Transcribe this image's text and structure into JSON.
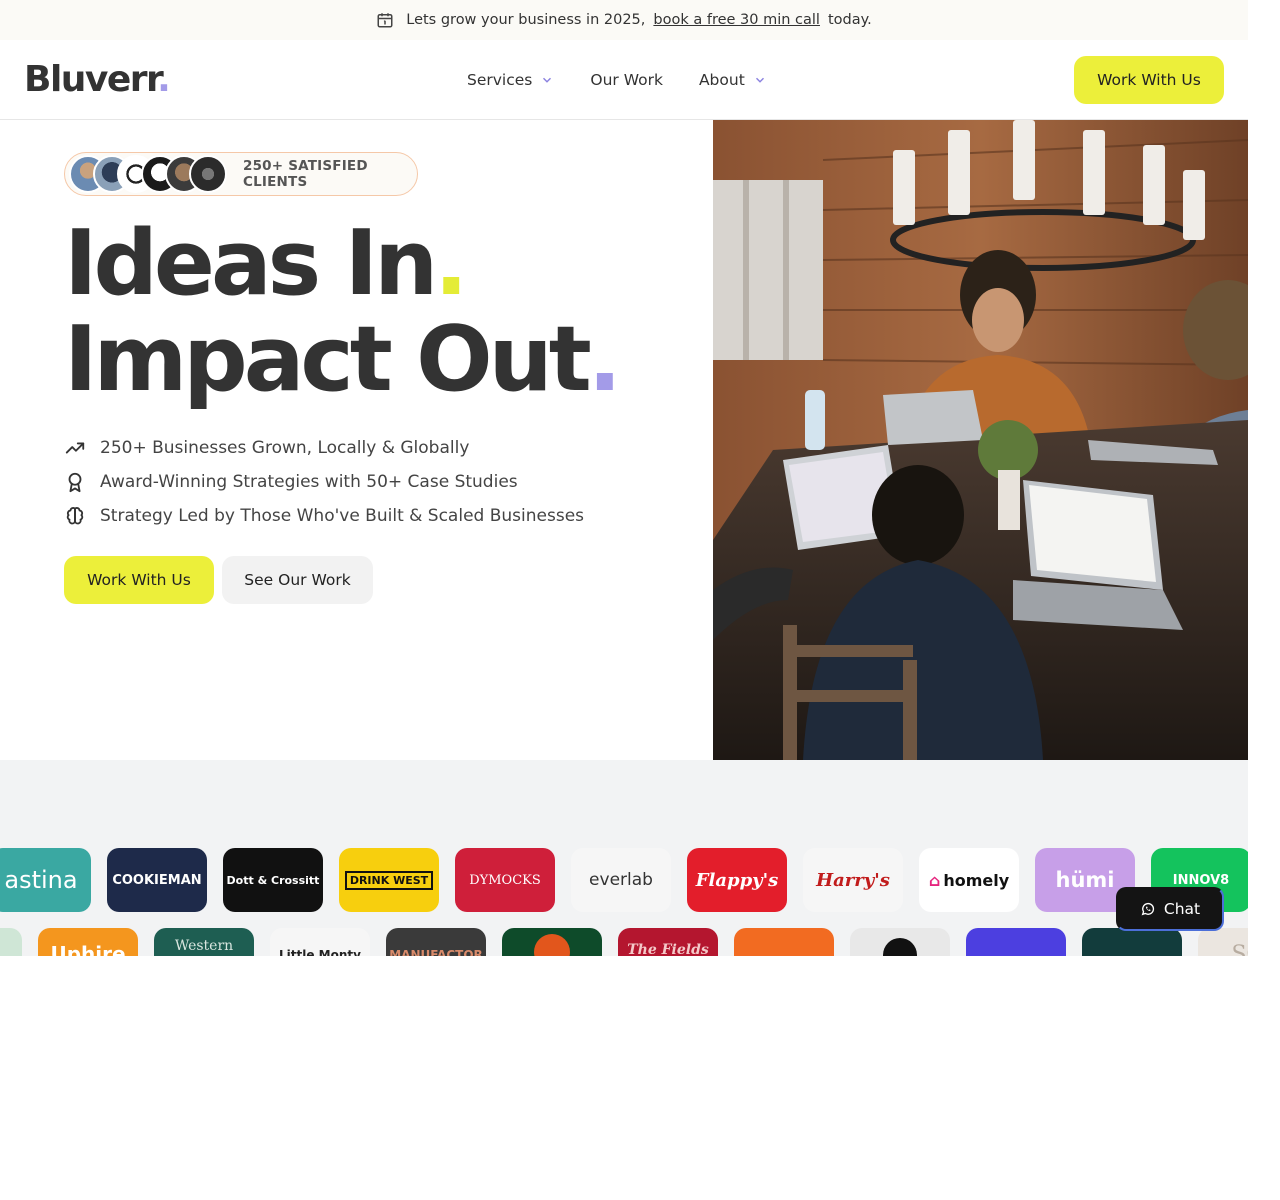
{
  "announcement": {
    "prefix": "Lets grow your business in 2025,",
    "link": "book a free 30 min call",
    "suffix": "today."
  },
  "header": {
    "logo": "Bluverr",
    "logo_dot": ".",
    "nav": [
      {
        "label": "Services",
        "has_dropdown": true
      },
      {
        "label": "Our Work",
        "has_dropdown": false
      },
      {
        "label": "About",
        "has_dropdown": true
      }
    ],
    "cta": "Work With Us"
  },
  "hero": {
    "clients_badge": "250+ SATISFIED CLIENTS",
    "headline_line1": "Ideas In",
    "headline_line2": "Impact Out",
    "dot": ".",
    "features": [
      {
        "icon": "trending-up-icon",
        "text": "250+ Businesses Grown, Locally & Globally"
      },
      {
        "icon": "award-icon",
        "text": "Award-Winning Strategies with 50+ Case Studies"
      },
      {
        "icon": "brain-icon",
        "text": "Strategy Led by Those Who've Built & Scaled Businesses"
      }
    ],
    "primary_button": "Work With Us",
    "secondary_button": "See Our Work"
  },
  "client_logos_row1": [
    "astina",
    "COOKIEMAN",
    "Dott & Crossitt",
    "DRINK WEST",
    "DYMOCKS",
    "everlab",
    "Flappy's",
    "Harry's",
    "homely",
    "hümi",
    "INNOV8"
  ],
  "client_logos_row2": [
    "",
    "Uphire",
    "Western",
    "Little Monty",
    "MANUFACTOR",
    "",
    "The Fields",
    "",
    "",
    "",
    "",
    "SO"
  ],
  "chat": {
    "label": "Chat"
  },
  "colors": {
    "accent_yellow": "#ecef3a",
    "accent_purple": "#a39be8",
    "text_dark": "#333333"
  }
}
